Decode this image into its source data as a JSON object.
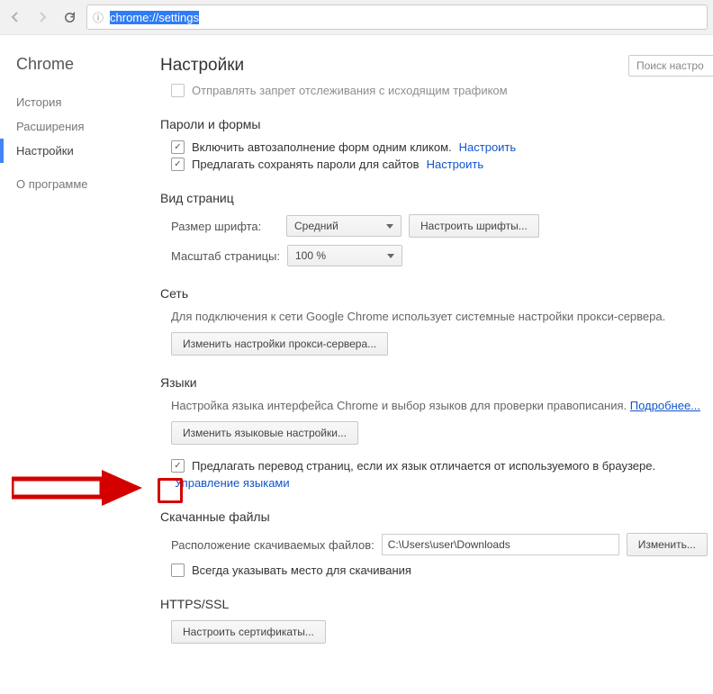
{
  "toolbar": {
    "url": "chrome://settings"
  },
  "sidebar": {
    "title": "Chrome",
    "items": [
      "История",
      "Расширения",
      "Настройки"
    ],
    "about": "О программе"
  },
  "page_title": "Настройки",
  "search_placeholder": "Поиск настро",
  "tracking": {
    "label": "Отправлять запрет отслеживания с исходящим трафиком"
  },
  "passwords": {
    "heading": "Пароли и формы",
    "autofill": "Включить автозаполнение форм одним кликом.",
    "autofill_link": "Настроить",
    "save_pw": "Предлагать сохранять пароли для сайтов",
    "save_pw_link": "Настроить"
  },
  "appearance": {
    "heading": "Вид страниц",
    "font_label": "Размер шрифта:",
    "font_value": "Средний",
    "font_btn": "Настроить шрифты...",
    "zoom_label": "Масштаб страницы:",
    "zoom_value": "100 %"
  },
  "network": {
    "heading": "Сеть",
    "desc": "Для подключения к сети Google Chrome использует системные настройки прокси-сервера.",
    "btn": "Изменить настройки прокси-сервера..."
  },
  "languages": {
    "heading": "Языки",
    "desc": "Настройка языка интерфейса Chrome и выбор языков для проверки правописания.",
    "more": "Подробнее...",
    "btn": "Изменить языковые настройки...",
    "translate": "Предлагать перевод страниц, если их язык отличается от используемого в браузере.",
    "manage": "Управление языками"
  },
  "downloads": {
    "heading": "Скачанные файлы",
    "path_label": "Расположение скачиваемых файлов:",
    "path": "C:\\Users\\user\\Downloads",
    "change": "Изменить...",
    "ask": "Всегда указывать место для скачивания"
  },
  "ssl": {
    "heading": "HTTPS/SSL",
    "btn": "Настроить сертификаты..."
  }
}
